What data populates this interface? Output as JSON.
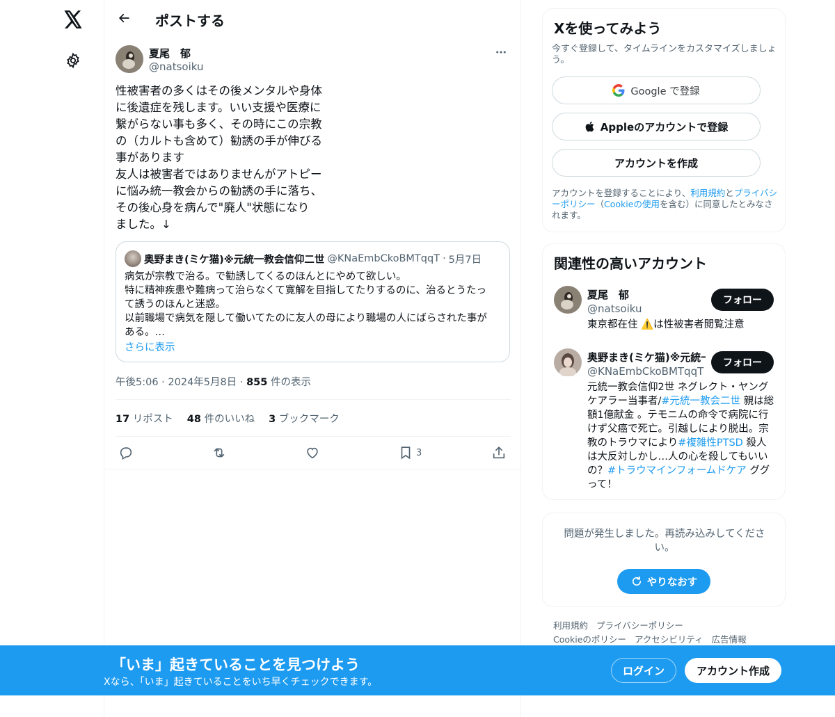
{
  "nav": {
    "logo_icon": "x-logo-icon",
    "settings_icon": "gear-icon"
  },
  "header": {
    "title": "ポストする",
    "back_icon": "arrow-left-icon"
  },
  "post": {
    "author_name": "夏尾　郁",
    "author_handle": "@natsoiku",
    "more_icon": "more-horizontal-icon",
    "text": "性被害者の多くはその後メンタルや身体\nに後遺症を残します。いい支援や医療に\n繋がらない事も多く、その時にこの宗教\nの（カルトも含めて）勧誘の手が伸びる\n事があります\n友人は被害者ではありませんがアトピー\nに悩み統一教会からの勧誘の手に落ち、\nその後心身を病んで\"廃人\"状態になり\nました。↓",
    "quote": {
      "name": "奥野まき(ミケ猫)※元統一教会信仰二世",
      "handle": "@KNaEmbCkoBMTqqT",
      "separator": "·",
      "date": "5月7日",
      "text": "病気が宗教で治る。で勧誘してくるのほんとにやめて欲しい。\n特に精神疾患や難病って治らなくて寛解を目指してたりするのに、治るとうたっ\nて誘うのほんと迷惑。\n以前職場で病気を隠して働いてたのに友人の母により職場の人にばらされた事が\nある。…",
      "show_more": "さらに表示"
    },
    "time": "午後5:06 · 2024年5月8日 ·",
    "views_count": "855",
    "views_label": "件の表示",
    "reposts_count": "17",
    "reposts_label": "リポスト",
    "likes_count": "48",
    "likes_label": "件のいいね",
    "bookmarks_count": "3",
    "bookmarks_label": "ブックマーク",
    "actions": {
      "reply_icon": "reply-icon",
      "repost_icon": "repost-icon",
      "like_icon": "heart-icon",
      "bookmark_icon": "bookmark-icon",
      "bookmark_count": "3",
      "share_icon": "share-icon"
    }
  },
  "signup": {
    "title": "Xを使ってみよう",
    "subtitle": "今すぐ登録して、タイムラインをカスタマイズしましょう。",
    "google_label": "Google で登録",
    "apple_label": "Appleのアカウントで登録",
    "create_label": "アカウントを作成",
    "legal_pre": "アカウントを登録することにより、",
    "legal_terms": "利用規約",
    "legal_and": "と",
    "legal_privacy": "プライバシーポリシー",
    "legal_paren_open": "（",
    "legal_cookie": "Cookieの使用",
    "legal_post": "を含む）に同意したとみなされます。"
  },
  "related": {
    "title": "関連性の高いアカウント",
    "follow_label": "フォロー",
    "accounts": [
      {
        "name": "夏尾　郁",
        "handle": "@natsoiku",
        "bio": "東京都在住 ⚠️は性被害者閲覧注意"
      },
      {
        "name": "奥野まき(ミケ猫)※元統一教会信仰二世",
        "handle": "@KNaEmbCkoBMTqqT",
        "bio_1": "元統一教会信仰2世 ネグレクト・ヤング\nケアラー当事者/",
        "tag_1": "#元統一教会二世",
        "bio_2": " 親は総額1億献金 。テモニムの命令で病院に行けず父癌で死亡。引越しにより脱出。宗教のトラウマにより",
        "tag_2": "#複雑性PTSD",
        "bio_3": " 殺人は大反対しかし…人の心を殺してもいいの？",
        "tag_3": "#トラウマインフォームドケア",
        "bio_4": " ググって！"
      }
    ]
  },
  "error": {
    "text": "問題が発生しました。再読み込みしてください。",
    "retry_label": "やりなおす",
    "retry_icon": "refresh-icon"
  },
  "footer": {
    "links": [
      "利用規約",
      "プライバシーポリシー",
      "Cookieのポリシー",
      "アクセシビリティ",
      "広告情報"
    ]
  },
  "banner": {
    "title": "「いま」起きていることを見つけよう",
    "subtitle": "Xなら、「いま」起きていることをいち早くチェックできます。",
    "login_label": "ログイン",
    "create_label": "アカウント作成"
  },
  "colors": {
    "accent": "#1d9bf0",
    "text": "#0f1419",
    "muted": "#536471",
    "border": "#eff3f4"
  }
}
